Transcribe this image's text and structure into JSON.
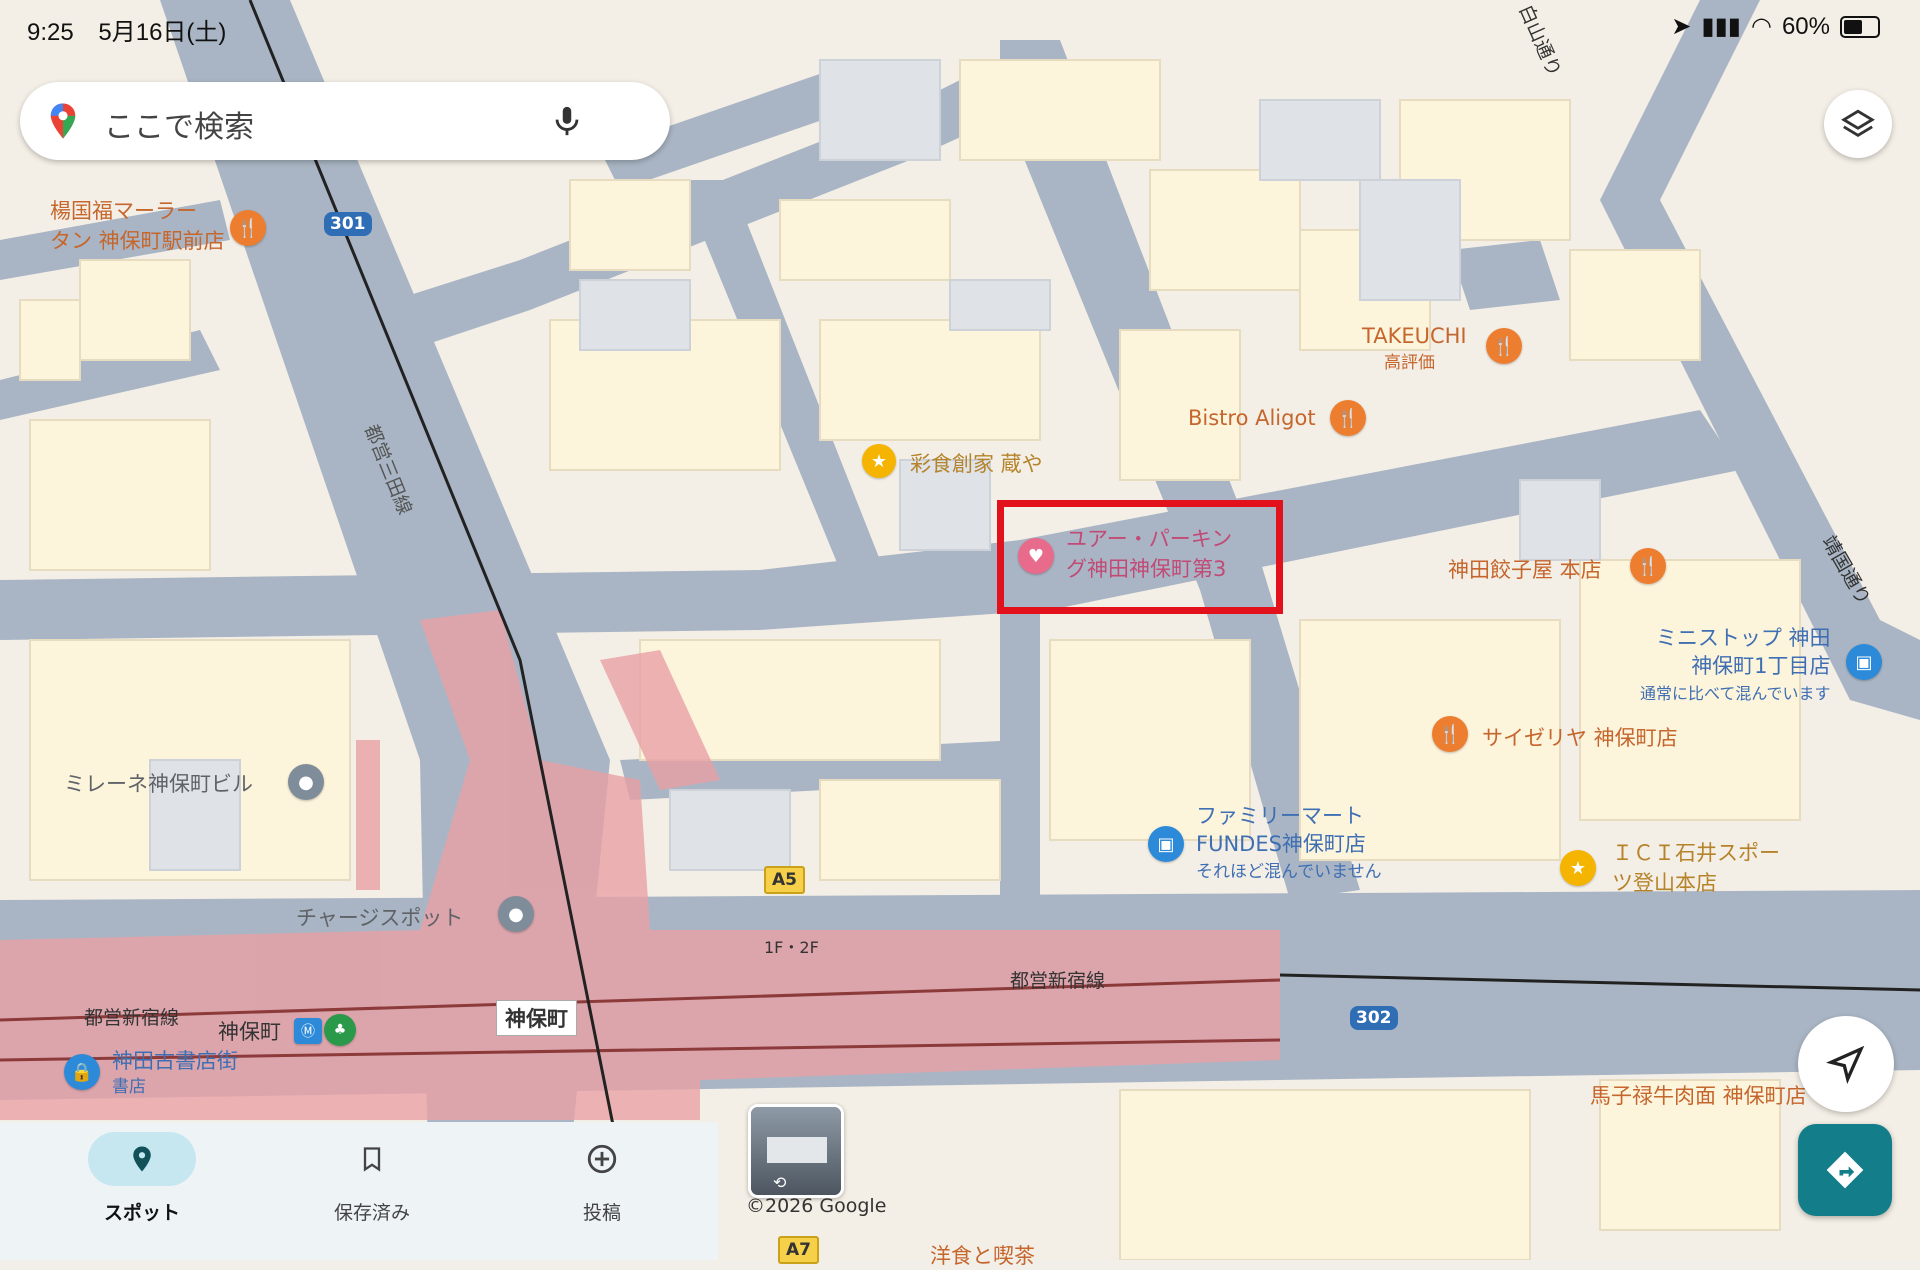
{
  "status": {
    "time": "9:25",
    "date": "5月16日(土)",
    "battery": "60%"
  },
  "search": {
    "placeholder": "ここで検索"
  },
  "map": {
    "pois": [
      {
        "name": "楊国福マーラータン 神保町駅前店",
        "line1": "楊国福マーラー",
        "line2": "タン 神保町駅前店"
      },
      {
        "name": "TAKEUCHI",
        "sub": "高評価"
      },
      {
        "name": "Bistro Aligot"
      },
      {
        "name": "彩食創家 蔵や"
      },
      {
        "name": "ユアー・パーキング神田神保町第3",
        "line1": "ユアー・パーキン",
        "line2": "グ神田神保町第3"
      },
      {
        "name": "神田餃子屋 本店"
      },
      {
        "name": "ミニストップ 神田神保町1丁目店",
        "line1": "ミニストップ 神田",
        "line2": "神保町1丁目店",
        "sub": "通常に比べて混んでいます"
      },
      {
        "name": "サイゼリヤ 神保町店"
      },
      {
        "name": "ミレーネ神保町ビル"
      },
      {
        "name": "ファミリーマート FUNDES神保町店",
        "line1": "ファミリーマート",
        "line2": "FUNDES神保町店",
        "sub": "それほど混んでいません"
      },
      {
        "name": "ＩＣＩ石井スポーツ登山本店",
        "line1": "ＩＣＩ石井スポー",
        "line2": "ツ登山本店"
      },
      {
        "name": "チャージスポット"
      },
      {
        "name": "神保町"
      },
      {
        "name": "神田古書店街",
        "sub": "書店"
      },
      {
        "name": "馬子禄牛肉面 神保町店"
      },
      {
        "name": "洋食と喫茶"
      }
    ],
    "street_labels": {
      "mita_line": "都営三田線",
      "shinjuku_line_1": "都営新宿線",
      "shinjuku_line_2": "都営新宿線",
      "yasukuni": "靖国通り",
      "hakusan": "白山通り"
    },
    "route_shields": {
      "r301": "301",
      "r302": "302"
    },
    "exits": {
      "a5": "A5",
      "a7": "A7",
      "floor": "1F・2F"
    },
    "station": "神保町"
  },
  "bottom_nav": {
    "tabs": [
      {
        "label": "スポット",
        "active": true
      },
      {
        "label": "保存済み",
        "active": false
      },
      {
        "label": "投稿",
        "active": false
      }
    ]
  },
  "copyright": "©2026 Google",
  "colors": {
    "accent": "#137d8a",
    "highlight": "#e3111c",
    "rail_area": "#e8a1a6"
  }
}
